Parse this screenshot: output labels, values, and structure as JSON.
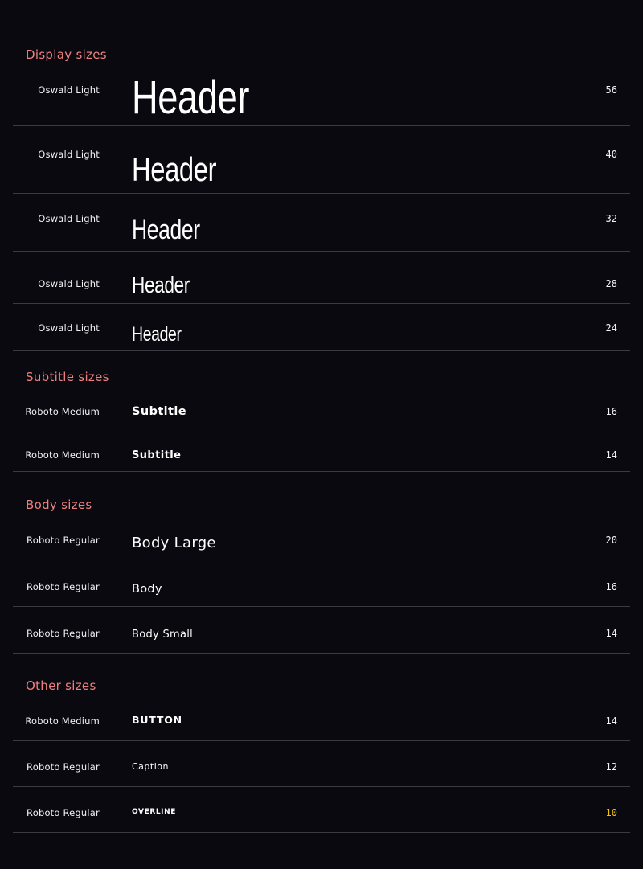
{
  "sections": {
    "display": "Display sizes",
    "subtitle": "Subtitle sizes",
    "body": "Body sizes",
    "other": "Other sizes"
  },
  "display_rows": [
    {
      "font": "Oswald Light",
      "sample": "Header",
      "size": "56"
    },
    {
      "font": "Oswald Light",
      "sample": "Header",
      "size": "40"
    },
    {
      "font": "Oswald Light",
      "sample": "Header",
      "size": "32"
    },
    {
      "font": "Oswald Light",
      "sample": "Header",
      "size": "28"
    },
    {
      "font": "Oswald Light",
      "sample": "Header",
      "size": "24"
    }
  ],
  "subtitle_rows": [
    {
      "font": "Roboto Medium",
      "sample": "Subtitle",
      "size": "16"
    },
    {
      "font": "Roboto Medium",
      "sample": "Subtitle",
      "size": "14"
    }
  ],
  "body_rows": [
    {
      "font": "Roboto Regular",
      "sample": "Body Large",
      "size": "20"
    },
    {
      "font": "Roboto Regular",
      "sample": "Body",
      "size": "16"
    },
    {
      "font": "Roboto Regular",
      "sample": "Body Small",
      "size": "14"
    }
  ],
  "other_rows": [
    {
      "font": "Roboto Medium",
      "sample": "BUTTON",
      "size": "14"
    },
    {
      "font": "Roboto Regular",
      "sample": "Caption",
      "size": "12"
    },
    {
      "font": "Roboto Regular",
      "sample": "OVERLINE",
      "size": "10"
    }
  ],
  "colors": {
    "background": "#0a0910",
    "section_title": "#f08080",
    "divider": "#3a3a42",
    "highlight_size": "#f0c419"
  }
}
